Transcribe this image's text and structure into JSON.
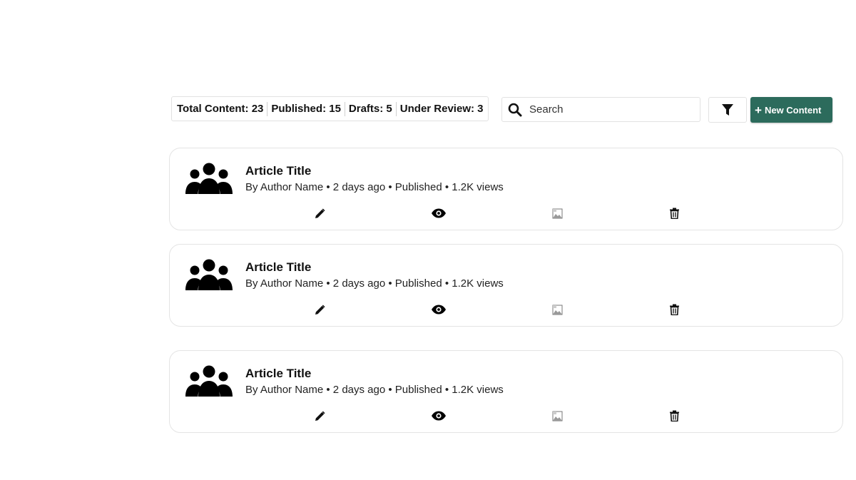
{
  "stats": {
    "total": "Total Content: 23",
    "published": "Published: 15",
    "drafts": "Drafts: 5",
    "review": "Under Review: 3"
  },
  "search": {
    "placeholder": "Search",
    "value": ""
  },
  "toolbar": {
    "new_label": "New Content",
    "new_icon": "plus-icon",
    "filter_icon": "filter-icon",
    "accent_color": "#2c6b5c"
  },
  "articles": [
    {
      "title": "Article Title",
      "meta": "By Author Name • 2 days ago • Published • 1.2K views",
      "icon": "users-group-icon"
    },
    {
      "title": "Article Title",
      "meta": "By Author Name • 2 days ago • Published • 1.2K views",
      "icon": "users-group-icon"
    },
    {
      "title": "Article Title",
      "meta": "By Author Name • 2 days ago • Published • 1.2K views",
      "icon": "users-group-icon"
    }
  ],
  "actions": [
    "pencil-icon",
    "eye-icon",
    "image-icon",
    "trash-icon"
  ]
}
